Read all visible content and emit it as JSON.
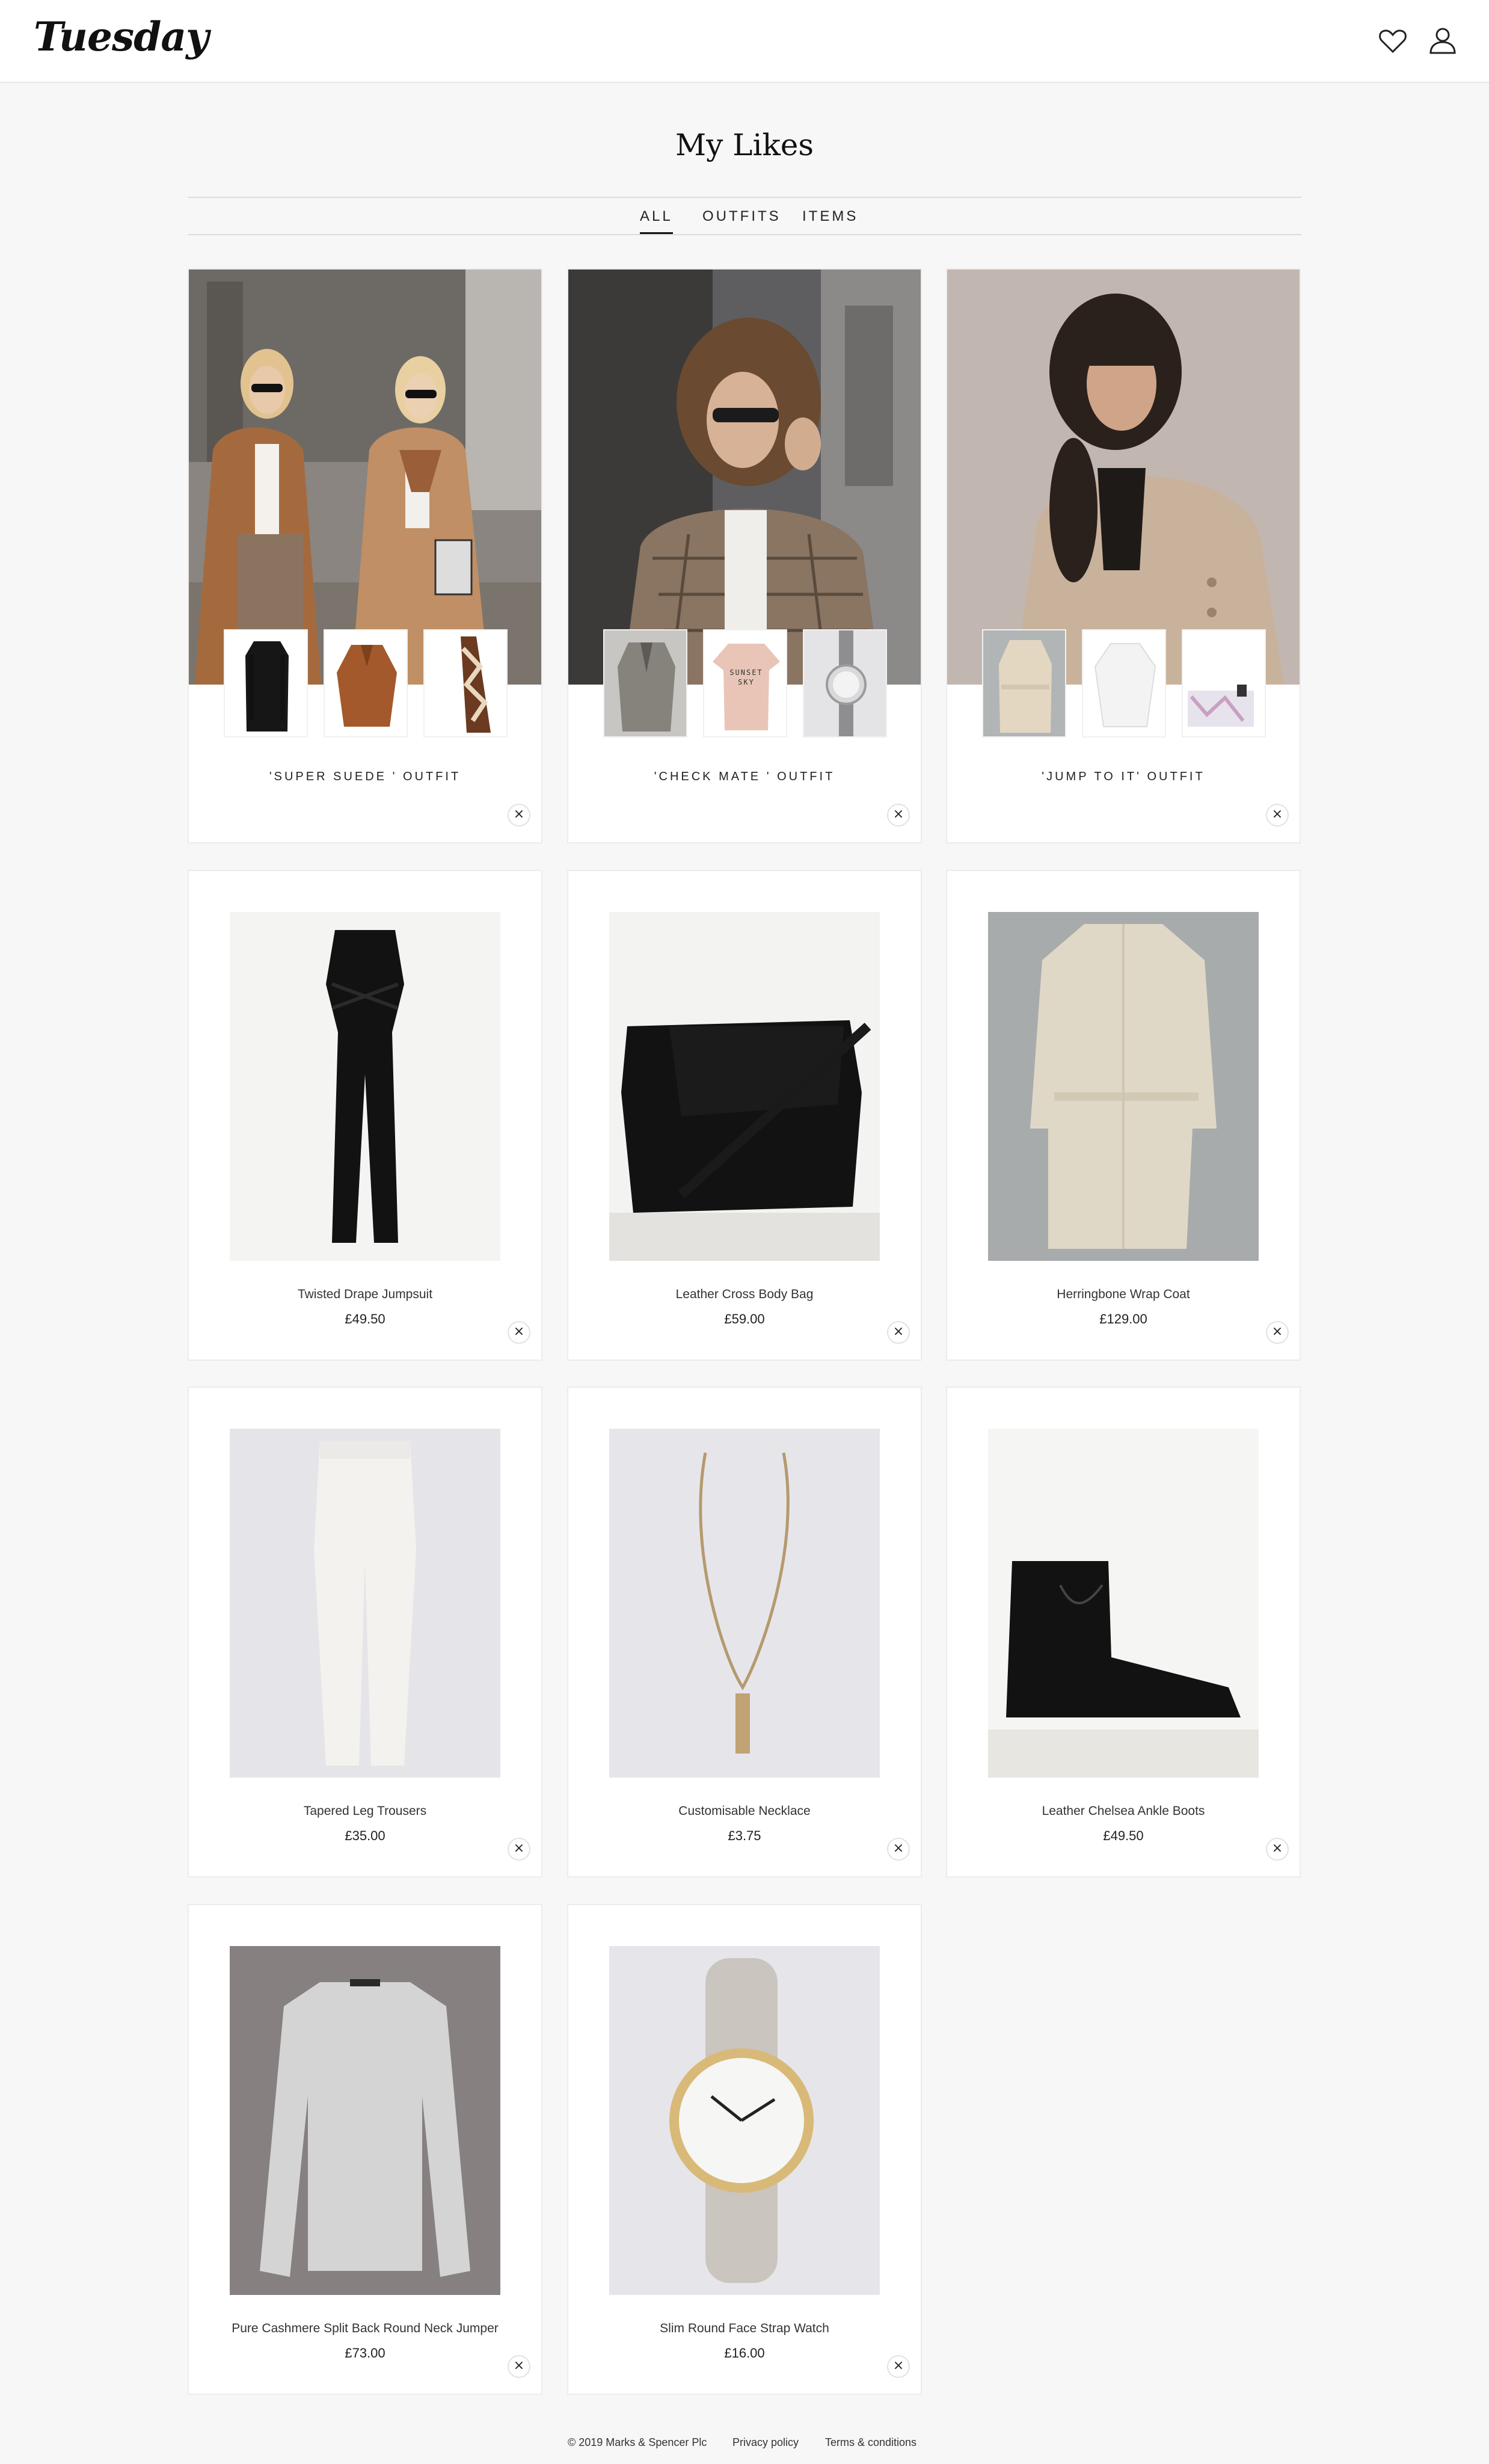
{
  "header": {
    "logo": "Tuesday"
  },
  "page": {
    "title": "My Likes"
  },
  "tabs": [
    {
      "label": "ALL",
      "active": true
    },
    {
      "label": "OUTFITS",
      "active": false
    },
    {
      "label": "ITEMS",
      "active": false
    }
  ],
  "outfits": [
    {
      "name": "'SUPER SUEDE ' OUTFIT",
      "remove": "×"
    },
    {
      "name": "'CHECK MATE ' OUTFIT",
      "remove": "×"
    },
    {
      "name": "'JUMP TO IT' OUTFIT",
      "remove": "×"
    }
  ],
  "outfit_thumbs": {
    "two_tshirt_text": "SUNSET SKY"
  },
  "items": [
    {
      "name": "Twisted Drape Jumpsuit",
      "price": "£49.50",
      "remove": "×"
    },
    {
      "name": "Leather Cross Body Bag",
      "price": "£59.00",
      "remove": "×"
    },
    {
      "name": "Herringbone Wrap Coat",
      "price": "£129.00",
      "remove": "×"
    },
    {
      "name": "Tapered Leg Trousers",
      "price": "£35.00",
      "remove": "×"
    },
    {
      "name": "Customisable Necklace",
      "price": "£3.75",
      "remove": "×"
    },
    {
      "name": "Leather Chelsea Ankle Boots",
      "price": "£49.50",
      "remove": "×"
    },
    {
      "name": "Pure Cashmere Split Back Round Neck Jumper",
      "price": "£73.00",
      "remove": "×"
    },
    {
      "name": "Slim Round Face Strap Watch",
      "price": "£16.00",
      "remove": "×"
    }
  ],
  "footer": {
    "copyright": "© 2019 Marks & Spencer Plc",
    "privacy": "Privacy policy",
    "terms": "Terms & conditions"
  },
  "colors": {
    "background": "#f7f7f7",
    "card": "#ffffff",
    "text": "#222222"
  }
}
